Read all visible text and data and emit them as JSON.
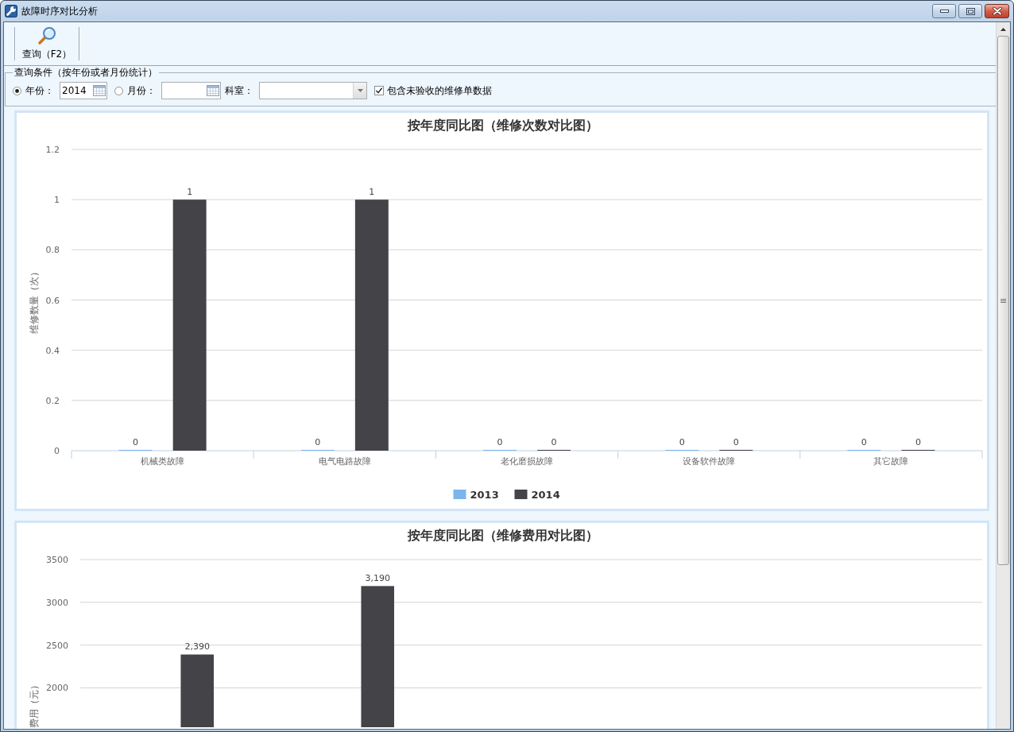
{
  "window": {
    "title": "故障时序对比分析"
  },
  "toolbar": {
    "buttons": [
      {
        "label": "查询（F2）"
      }
    ]
  },
  "query_conditions": {
    "title": "查询条件（按年份或者月份统计）",
    "fields": [
      {
        "kind": "year",
        "label": "年份：",
        "selected": true,
        "value": "2014"
      },
      {
        "kind": "month",
        "label": "月份：",
        "selected": false
      },
      {
        "kind": "combo",
        "label": "科室："
      },
      {
        "kind": "checkbox",
        "label": "包含未验收的维修单数据",
        "checked": true
      }
    ]
  },
  "charts": [
    {
      "chart_data": {
        "type": "bar",
        "title": "按年度同比图（维修次数对比图）",
        "ylabel": "维修数量（次）",
        "categories": [
          "机械类故障",
          "电气电路故障",
          "老化磨损故障",
          "设备软件故障",
          "其它故障"
        ],
        "series": [
          {
            "name": "2013",
            "color": "#7cb5ec",
            "values": [
              0,
              0,
              0,
              0,
              0
            ]
          },
          {
            "name": "2014",
            "color": "#434348",
            "values": [
              1,
              1,
              0,
              0,
              0
            ]
          }
        ],
        "ylim": [
          0,
          1.2
        ],
        "yticks": [
          0,
          0.2,
          0.4,
          0.6,
          0.8,
          1,
          1.2
        ],
        "grid": true,
        "legend": "bottom",
        "data_labels": true
      }
    },
    {
      "chart_data": {
        "type": "bar",
        "title": "按年度同比图（维修费用对比图）",
        "ylabel": "费用（元）",
        "series": [
          {
            "color": "#434348",
            "values": [
              2390,
              3190
            ]
          }
        ],
        "ylim": [
          1540,
          3500
        ],
        "yticks": [
          2000,
          2500,
          3000,
          3500
        ],
        "grid": true,
        "value_labels": [
          "2,390",
          "3,190"
        ]
      }
    }
  ]
}
